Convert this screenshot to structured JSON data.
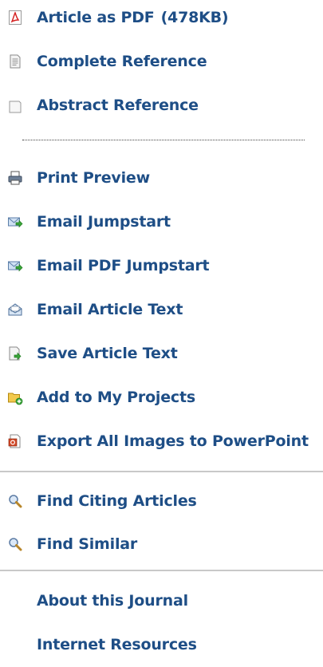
{
  "menu": {
    "article_pdf": {
      "label": "Article as PDF",
      "size": "(478KB)",
      "icon": "pdf-icon"
    },
    "complete_reference": {
      "label": "Complete Reference",
      "icon": "document-icon"
    },
    "abstract_reference": {
      "label": "Abstract Reference",
      "icon": "blank-document-icon"
    },
    "print_preview": {
      "label": "Print Preview",
      "icon": "printer-icon"
    },
    "email_jumpstart": {
      "label": "Email Jumpstart",
      "icon": "email-forward-icon"
    },
    "email_pdf_jumpstart": {
      "label": "Email PDF Jumpstart",
      "icon": "email-forward-icon"
    },
    "email_article_text": {
      "label": "Email Article Text",
      "icon": "open-envelope-icon"
    },
    "save_article_text": {
      "label": "Save Article Text",
      "icon": "save-document-icon"
    },
    "add_to_projects": {
      "label": "Add to My Projects",
      "icon": "folder-add-icon"
    },
    "export_images": {
      "label": "Export All Images to PowerPoint",
      "icon": "powerpoint-icon"
    },
    "find_citing": {
      "label": "Find Citing Articles",
      "icon": "magnifier-icon"
    },
    "find_similar": {
      "label": "Find Similar",
      "icon": "magnifier-icon"
    },
    "about_journal": {
      "label": "About this Journal"
    },
    "internet_resources": {
      "label": "Internet Resources"
    }
  },
  "colors": {
    "link": "#1e4e86",
    "divider": "#c8c8c8",
    "dotted_divider": "#444444"
  }
}
